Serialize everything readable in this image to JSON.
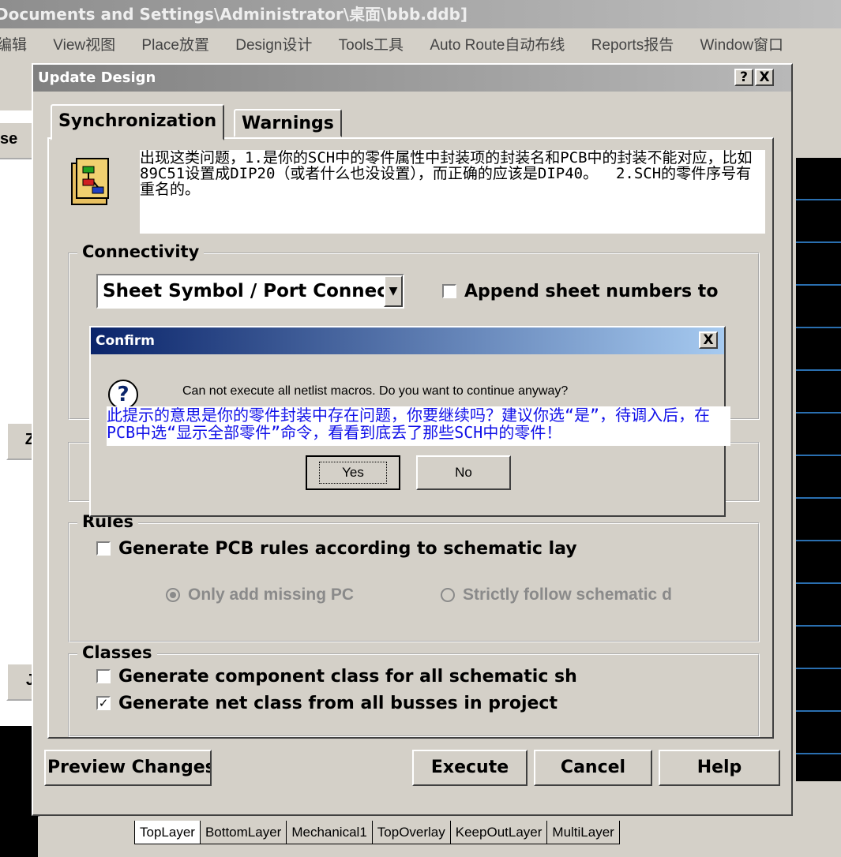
{
  "app": {
    "title": "Documents and Settings\\Administrator\\桌面\\bbb.ddb]",
    "menu": [
      "编辑",
      "View视图",
      "Place放置",
      "Design设计",
      "Tools工具",
      "Auto Route自动布线",
      "Reports报告",
      "Window窗口"
    ],
    "left_fragments": [
      "se",
      "Z",
      "J"
    ],
    "layer_tabs": [
      "TopLayer",
      "BottomLayer",
      "Mechanical1",
      "TopOverlay",
      "KeepOutLayer",
      "MultiLayer"
    ]
  },
  "update_dialog": {
    "title": "Update Design",
    "help_btn": "?",
    "close_btn": "X",
    "tabs": [
      "Synchronization",
      "Warnings"
    ],
    "info_text": "出现这类问题，1.是你的SCH中的零件属性中封装项的封装名和PCB中的封装不能对应，比如89C51设置成DIP20（或者什么也没设置），而正确的应该是DIP40。  2.SCH的零件序号有重名的。",
    "connectivity": {
      "legend": "Connectivity",
      "select_value": "Sheet Symbol / Port Connect",
      "append_label": "Append sheet numbers to",
      "append_checked": false
    },
    "rules": {
      "legend": "Rules",
      "generate_label": "Generate PCB rules according to schematic lay",
      "generate_checked": false,
      "radio_only": "Only add missing PC",
      "radio_strict": "Strictly follow schematic d",
      "selected": "only"
    },
    "classes": {
      "legend": "Classes",
      "component_label": "Generate component class for all schematic sh",
      "component_checked": false,
      "net_label": "Generate net class from all busses in project",
      "net_checked": true
    },
    "buttons": {
      "preview": "Preview Changes",
      "execute": "Execute",
      "cancel": "Cancel",
      "help": "Help"
    }
  },
  "confirm_dialog": {
    "title": "Confirm",
    "close_btn": "X",
    "icon": "?",
    "message": "Can not execute all netlist macros. Do you want to continue anyway?",
    "note": "此提示的意思是你的零件封装中存在问题，你要继续吗？建议你选“是”，待调入后，在PCB中选“显示全部零件”命令，看看到底丢了那些SCH中的零件！",
    "yes": "Yes",
    "no": "No"
  },
  "colors": {
    "active_title": "#0a246a",
    "inactive_title": "#808080",
    "note_text": "#1010e8",
    "face": "#d4d0c8"
  }
}
